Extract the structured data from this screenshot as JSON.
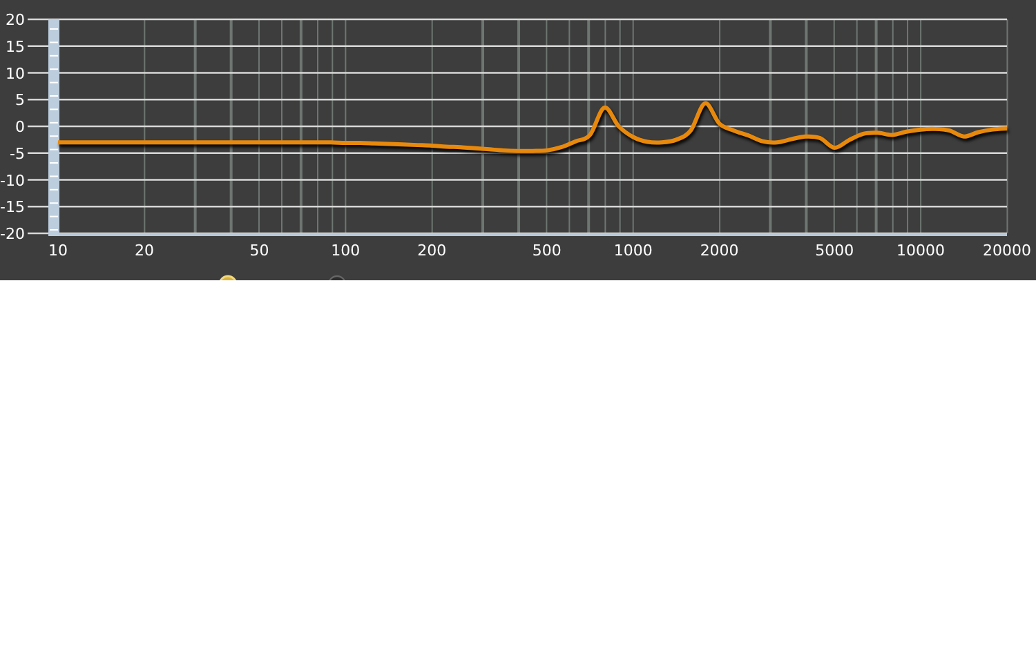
{
  "chart_data": {
    "type": "line",
    "categories": [
      "10",
      null,
      null,
      null,
      null,
      null,
      "20",
      null,
      null,
      null,
      null,
      null,
      null,
      null,
      "50",
      null,
      null,
      null,
      null,
      null,
      "100",
      null,
      null,
      null,
      null,
      null,
      "200",
      null,
      null,
      null,
      null,
      null,
      null,
      null,
      "500",
      null,
      null,
      null,
      null,
      null,
      "1000",
      null,
      null,
      null,
      null,
      null,
      "2000",
      null,
      null,
      null,
      null,
      null,
      null,
      null,
      "5000",
      null,
      null,
      null,
      null,
      null,
      "10000",
      null,
      null,
      null,
      null,
      null,
      "20000"
    ],
    "series": [
      {
        "color": "#e8890c",
        "values": [
          -3,
          -3,
          -3,
          -3,
          -3,
          -3,
          -3,
          -3,
          -3,
          -3,
          -3,
          -3,
          -3,
          -3,
          -3,
          -3,
          -3,
          -3,
          -3,
          -3,
          -3.1,
          -3.1,
          -3.2,
          -3.3,
          -3.4,
          -3.5,
          -3.6,
          -3.8,
          -3.9,
          -4.1,
          -4.3,
          -4.5,
          -4.6,
          -4.6,
          -4.5,
          -3.9,
          -2.8,
          -1.6,
          3.5,
          0,
          -2,
          -2.9,
          -3,
          -2.5,
          -0.8,
          4.3,
          0.5,
          -0.8,
          -1.7,
          -2.8,
          -3,
          -2.4,
          -1.9,
          -2.2,
          -4,
          -2.6,
          -1.4,
          -1.2,
          -1.6,
          -1,
          -0.6,
          -0.5,
          -0.8,
          -1.9,
          -1.1,
          -0.6,
          -0.4
        ]
      }
    ],
    "ylim": [
      -20,
      20
    ],
    "grid": true,
    "yticks": [
      20,
      15,
      10,
      5,
      0,
      -5,
      -10,
      -15,
      -20
    ]
  }
}
